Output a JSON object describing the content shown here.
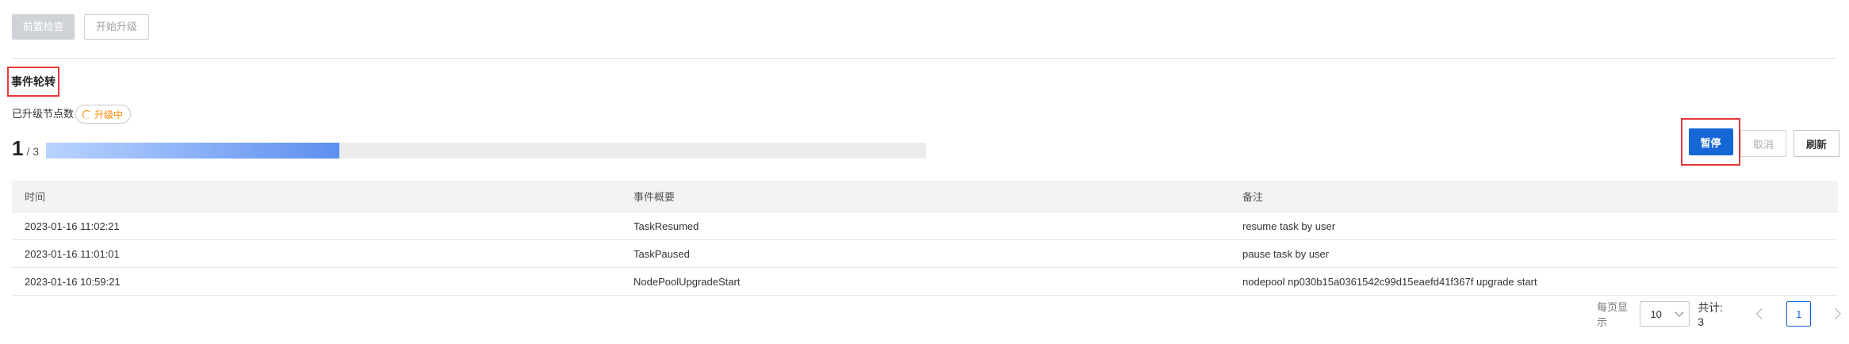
{
  "toolbar": {
    "precheck_label": "前置检查",
    "start_label": "开始升级"
  },
  "section": {
    "title": "事件轮转",
    "upgraded_nodes_label": "已升级节点数",
    "status_badge": "升级中",
    "status_icon": "spinner-icon",
    "status_color": "#ff8a00"
  },
  "progress": {
    "done": "1",
    "total_text": "/ 3",
    "fraction": 0.333
  },
  "actions": {
    "pause_label": "暂停",
    "cancel_label": "取消",
    "refresh_label": "刷新",
    "accent_color": "#1567d6"
  },
  "table": {
    "columns": [
      "时间",
      "事件概要",
      "备注"
    ],
    "rows": [
      [
        "2023-01-16 11:02:21",
        "TaskResumed",
        "resume task by user"
      ],
      [
        "2023-01-16 11:01:01",
        "TaskPaused",
        "pause task by user"
      ],
      [
        "2023-01-16 10:59:21",
        "NodePoolUpgradeStart",
        "nodepool np030b15a0361542c99d15eaefd41f367f upgrade start"
      ]
    ]
  },
  "pagination": {
    "per_page_label": "每页显示",
    "page_size": "10",
    "total_text": "共计: 3",
    "current_page": "1"
  }
}
